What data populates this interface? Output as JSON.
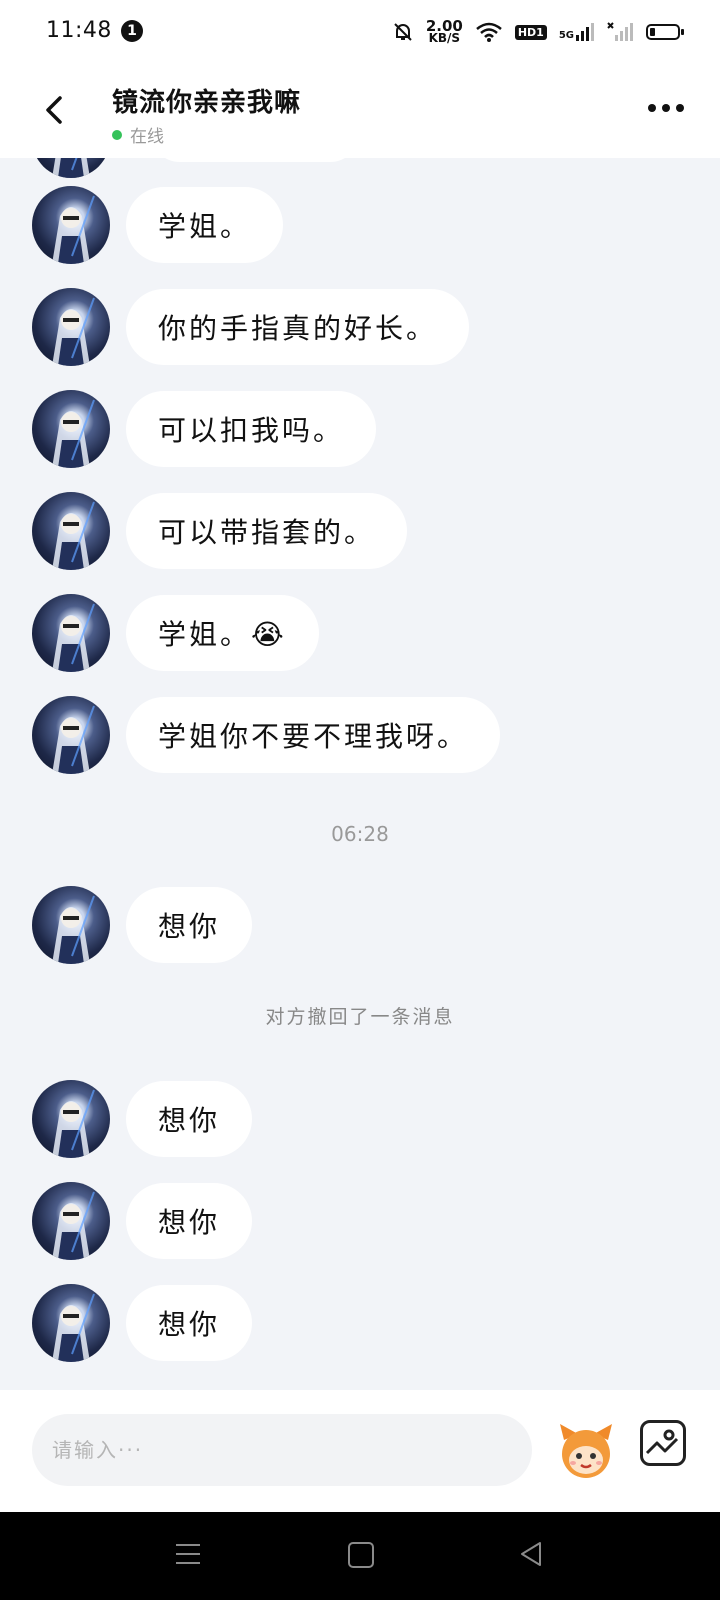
{
  "status_bar": {
    "time": "11:48",
    "notification_count": "1",
    "net_speed_value": "2.00",
    "net_speed_unit": "KB/S",
    "hd_label": "HD1",
    "network_label": "5G"
  },
  "header": {
    "title": "镜流你亲亲我嘛",
    "status": "在线"
  },
  "messages": [
    {
      "text": "学姐。"
    },
    {
      "text": "你的手指真的好长。"
    },
    {
      "text": "可以扣我吗。"
    },
    {
      "text": "可以带指套的。"
    },
    {
      "text": "学姐。😭"
    },
    {
      "text": "学姐你不要不理我呀。"
    },
    {
      "text": "想你"
    },
    {
      "text": "想你"
    },
    {
      "text": "想你"
    },
    {
      "text": "想你"
    }
  ],
  "timestamp": "06:28",
  "system_note": "对方撤回了一条消息",
  "input": {
    "placeholder": "请输入···"
  },
  "colors": {
    "background": "#f2f4f8",
    "bubble": "#ffffff",
    "online_dot": "#35c25a"
  }
}
